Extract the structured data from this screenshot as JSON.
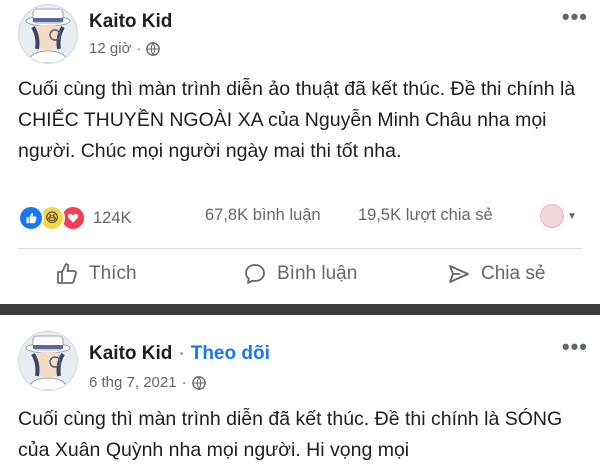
{
  "post1": {
    "author": "Kaito Kid",
    "time": "12 giờ",
    "text": "Cuối cùng thì màn trình diễn ảo thuật đã kết thúc. Đề thi chính là CHIẾC THUYỀN NGOÀI XA của Nguyễn Minh Châu nha mọi người. Chúc mọi người ngày mai thi tốt nha.",
    "reactions_count": "124K",
    "comments": "67,8K bình luận",
    "shares": "19,5K lượt chia sẻ",
    "actions": {
      "like": "Thích",
      "comment": "Bình luận",
      "share": "Chia sẻ"
    }
  },
  "post2": {
    "author": "Kaito Kid",
    "separator": "·",
    "follow": "Theo dõi",
    "time": "6 thg 7, 2021",
    "text": "Cuối cùng thì màn trình diễn đã kết thúc. Đề thi chính là SÓNG của Xuân Quỳnh nha mọi người. Hi vọng mọi"
  },
  "icons": [
    "globe-icon",
    "more-options-icon",
    "like-reaction-icon",
    "haha-reaction-icon",
    "love-reaction-icon",
    "thumbs-up-icon",
    "comment-icon",
    "share-icon"
  ],
  "colors": {
    "link_blue": "#1877f2",
    "secondary_text": "#65676b",
    "separator": "#3a3b3c"
  }
}
